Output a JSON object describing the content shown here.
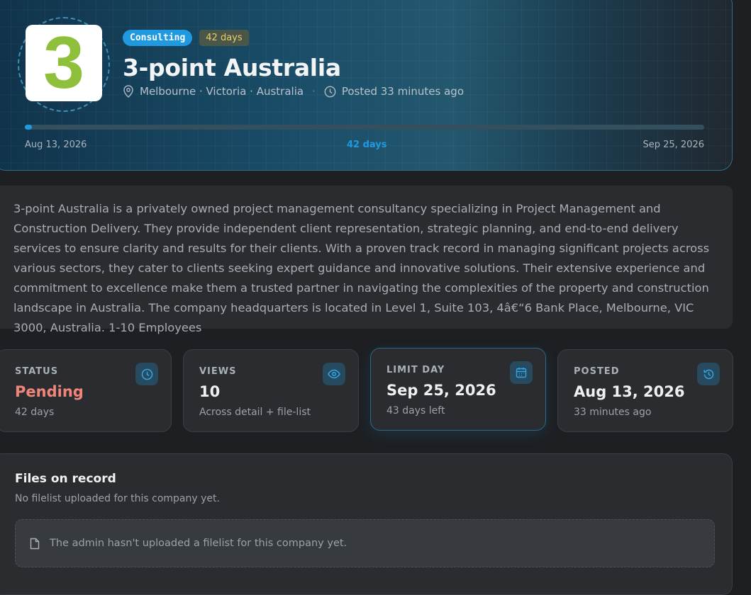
{
  "company": {
    "logo_text": "3",
    "category": "Consulting",
    "age_badge": "42 days",
    "name": "3-point Australia",
    "location": "Melbourne · Victoria · Australia",
    "posted_relative": "Posted 33 minutes ago"
  },
  "timeline": {
    "start": "Aug 13, 2026",
    "middle": "42 days",
    "end": "Sep 25, 2026",
    "progress_fraction": 0.01
  },
  "description": "3-point Australia is a privately owned project management consultancy specializing in Project Management and Construction Delivery. They provide independent client representation, strategic planning, and end-to-end delivery services to ensure clarity and results for their clients. With a proven track record in managing significant projects across various sectors, they cater to clients seeking expert guidance and innovative solutions. Their extensive experience and commitment to excellence make them a trusted partner in navigating the complexities of the property and construction landscape in Australia. The company headquarters is located in Level 1, Suite 103, 4â€“6 Bank Place, Melbourne, VIC 3000, Australia. 1-10 Employees",
  "stats": [
    {
      "label": "STATUS",
      "value": "Pending",
      "sub": "42 days",
      "icon": "clock-icon",
      "value_color": "#f0857a"
    },
    {
      "label": "VIEWS",
      "value": "10",
      "sub": "Across detail + file-list",
      "icon": "eye-icon"
    },
    {
      "label": "LIMIT DAY",
      "value": "Sep 25, 2026",
      "sub": "43 days left",
      "icon": "calendar-icon"
    },
    {
      "label": "POSTED",
      "value": "Aug 13, 2026",
      "sub": "33 minutes ago",
      "icon": "history-icon"
    }
  ],
  "files": {
    "title": "Files on record",
    "subtitle": "No filelist uploaded for this company yet.",
    "empty_message": "The admin hasn't uploaded a filelist for this company yet."
  },
  "colors": {
    "accent": "#1f9ae0",
    "logo_green": "#8ec03c",
    "pending": "#f0857a"
  }
}
